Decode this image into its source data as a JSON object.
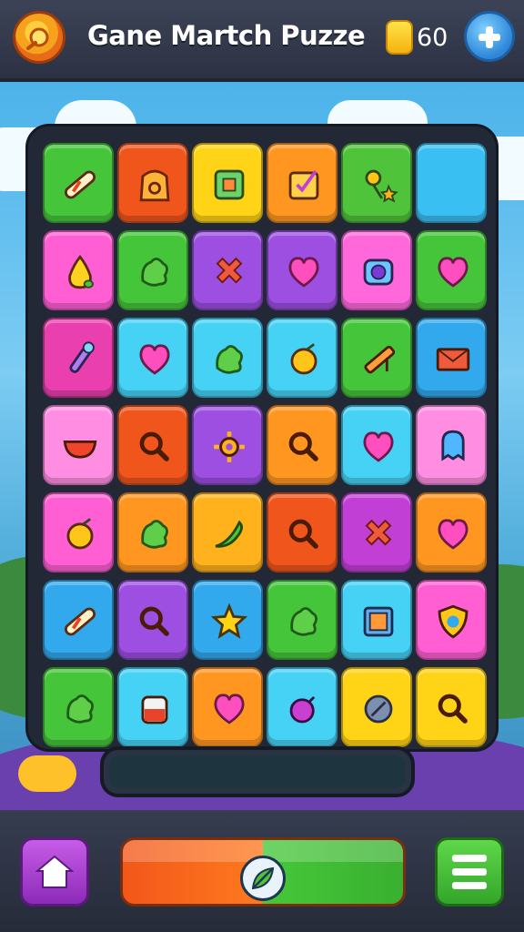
{
  "header": {
    "title": "Gane Martch Puzze",
    "coins": "60",
    "logo_icon": "sun-badge-icon",
    "coin_icon": "coin-icon",
    "add_icon": "plus-icon"
  },
  "board": {
    "rows": [
      [
        {
          "icon": "candy-stick-icon",
          "color": "#45c53a"
        },
        {
          "icon": "bag-icon",
          "color": "#f0561c"
        },
        {
          "icon": "square-box-icon",
          "color": "#ffd416"
        },
        {
          "icon": "checkbox-icon",
          "color": "#ff9620"
        },
        {
          "icon": "flower-star-icon",
          "color": "#4fc33a"
        },
        {
          "icon": "blank-icon",
          "color": "#39bff2"
        }
      ],
      [
        {
          "icon": "pear-icon",
          "color": "#ff5fd2"
        },
        {
          "icon": "leaf-blob-icon",
          "color": "#45c53a"
        },
        {
          "icon": "cross-icon",
          "color": "#9c4fe0"
        },
        {
          "icon": "heart-icon",
          "color": "#9c4fe0"
        },
        {
          "icon": "gem-frame-icon",
          "color": "#ff68da"
        },
        {
          "icon": "heart-icon",
          "color": "#45c53a"
        }
      ],
      [
        {
          "icon": "pipette-icon",
          "color": "#ea3fae"
        },
        {
          "icon": "heart-icon",
          "color": "#45d2f5"
        },
        {
          "icon": "leaf-blob-icon",
          "color": "#45d2f5"
        },
        {
          "icon": "fruit-icon",
          "color": "#45d2f5"
        },
        {
          "icon": "pencil-icon",
          "color": "#45c53a"
        },
        {
          "icon": "envelope-icon",
          "color": "#31a9ec"
        }
      ],
      [
        {
          "icon": "bowl-icon",
          "color": "#ff8ee3"
        },
        {
          "icon": "magnifier-icon",
          "color": "#f0561c"
        },
        {
          "icon": "gear-icon",
          "color": "#9c4fe0"
        },
        {
          "icon": "magnifier-icon",
          "color": "#ff9620"
        },
        {
          "icon": "heart-icon",
          "color": "#45d2f5"
        },
        {
          "icon": "ghost-icon",
          "color": "#ff8ee3"
        }
      ],
      [
        {
          "icon": "fruit-icon",
          "color": "#ff5fd2"
        },
        {
          "icon": "leaf-blob-icon",
          "color": "#ff9620"
        },
        {
          "icon": "chili-icon",
          "color": "#ffb21c"
        },
        {
          "icon": "magnifier-icon",
          "color": "#f0561c"
        },
        {
          "icon": "cross-icon",
          "color": "#c23fd6"
        },
        {
          "icon": "heart-icon",
          "color": "#ff9620"
        }
      ],
      [
        {
          "icon": "candy-stick-icon",
          "color": "#31a9ec"
        },
        {
          "icon": "magnifier-icon",
          "color": "#9c4fe0"
        },
        {
          "icon": "star-icon",
          "color": "#31a9ec"
        },
        {
          "icon": "leaf-blob-icon",
          "color": "#45c53a"
        },
        {
          "icon": "frame-icon",
          "color": "#45d2f5"
        },
        {
          "icon": "shield-icon",
          "color": "#ff5fd2"
        }
      ],
      [
        {
          "icon": "leaf-blob-icon",
          "color": "#45c53a"
        },
        {
          "icon": "jar-icon",
          "color": "#45d2f5"
        },
        {
          "icon": "heart-icon",
          "color": "#ff9620"
        },
        {
          "icon": "bomb-icon",
          "color": "#45d2f5"
        },
        {
          "icon": "coin-disc-icon",
          "color": "#ffd416"
        },
        {
          "icon": "magnifier-icon",
          "color": "#ffd416"
        }
      ]
    ]
  },
  "footer": {
    "home_icon": "home-icon",
    "play_icon": "play-leaf-icon",
    "menu_icon": "menu-icon"
  }
}
